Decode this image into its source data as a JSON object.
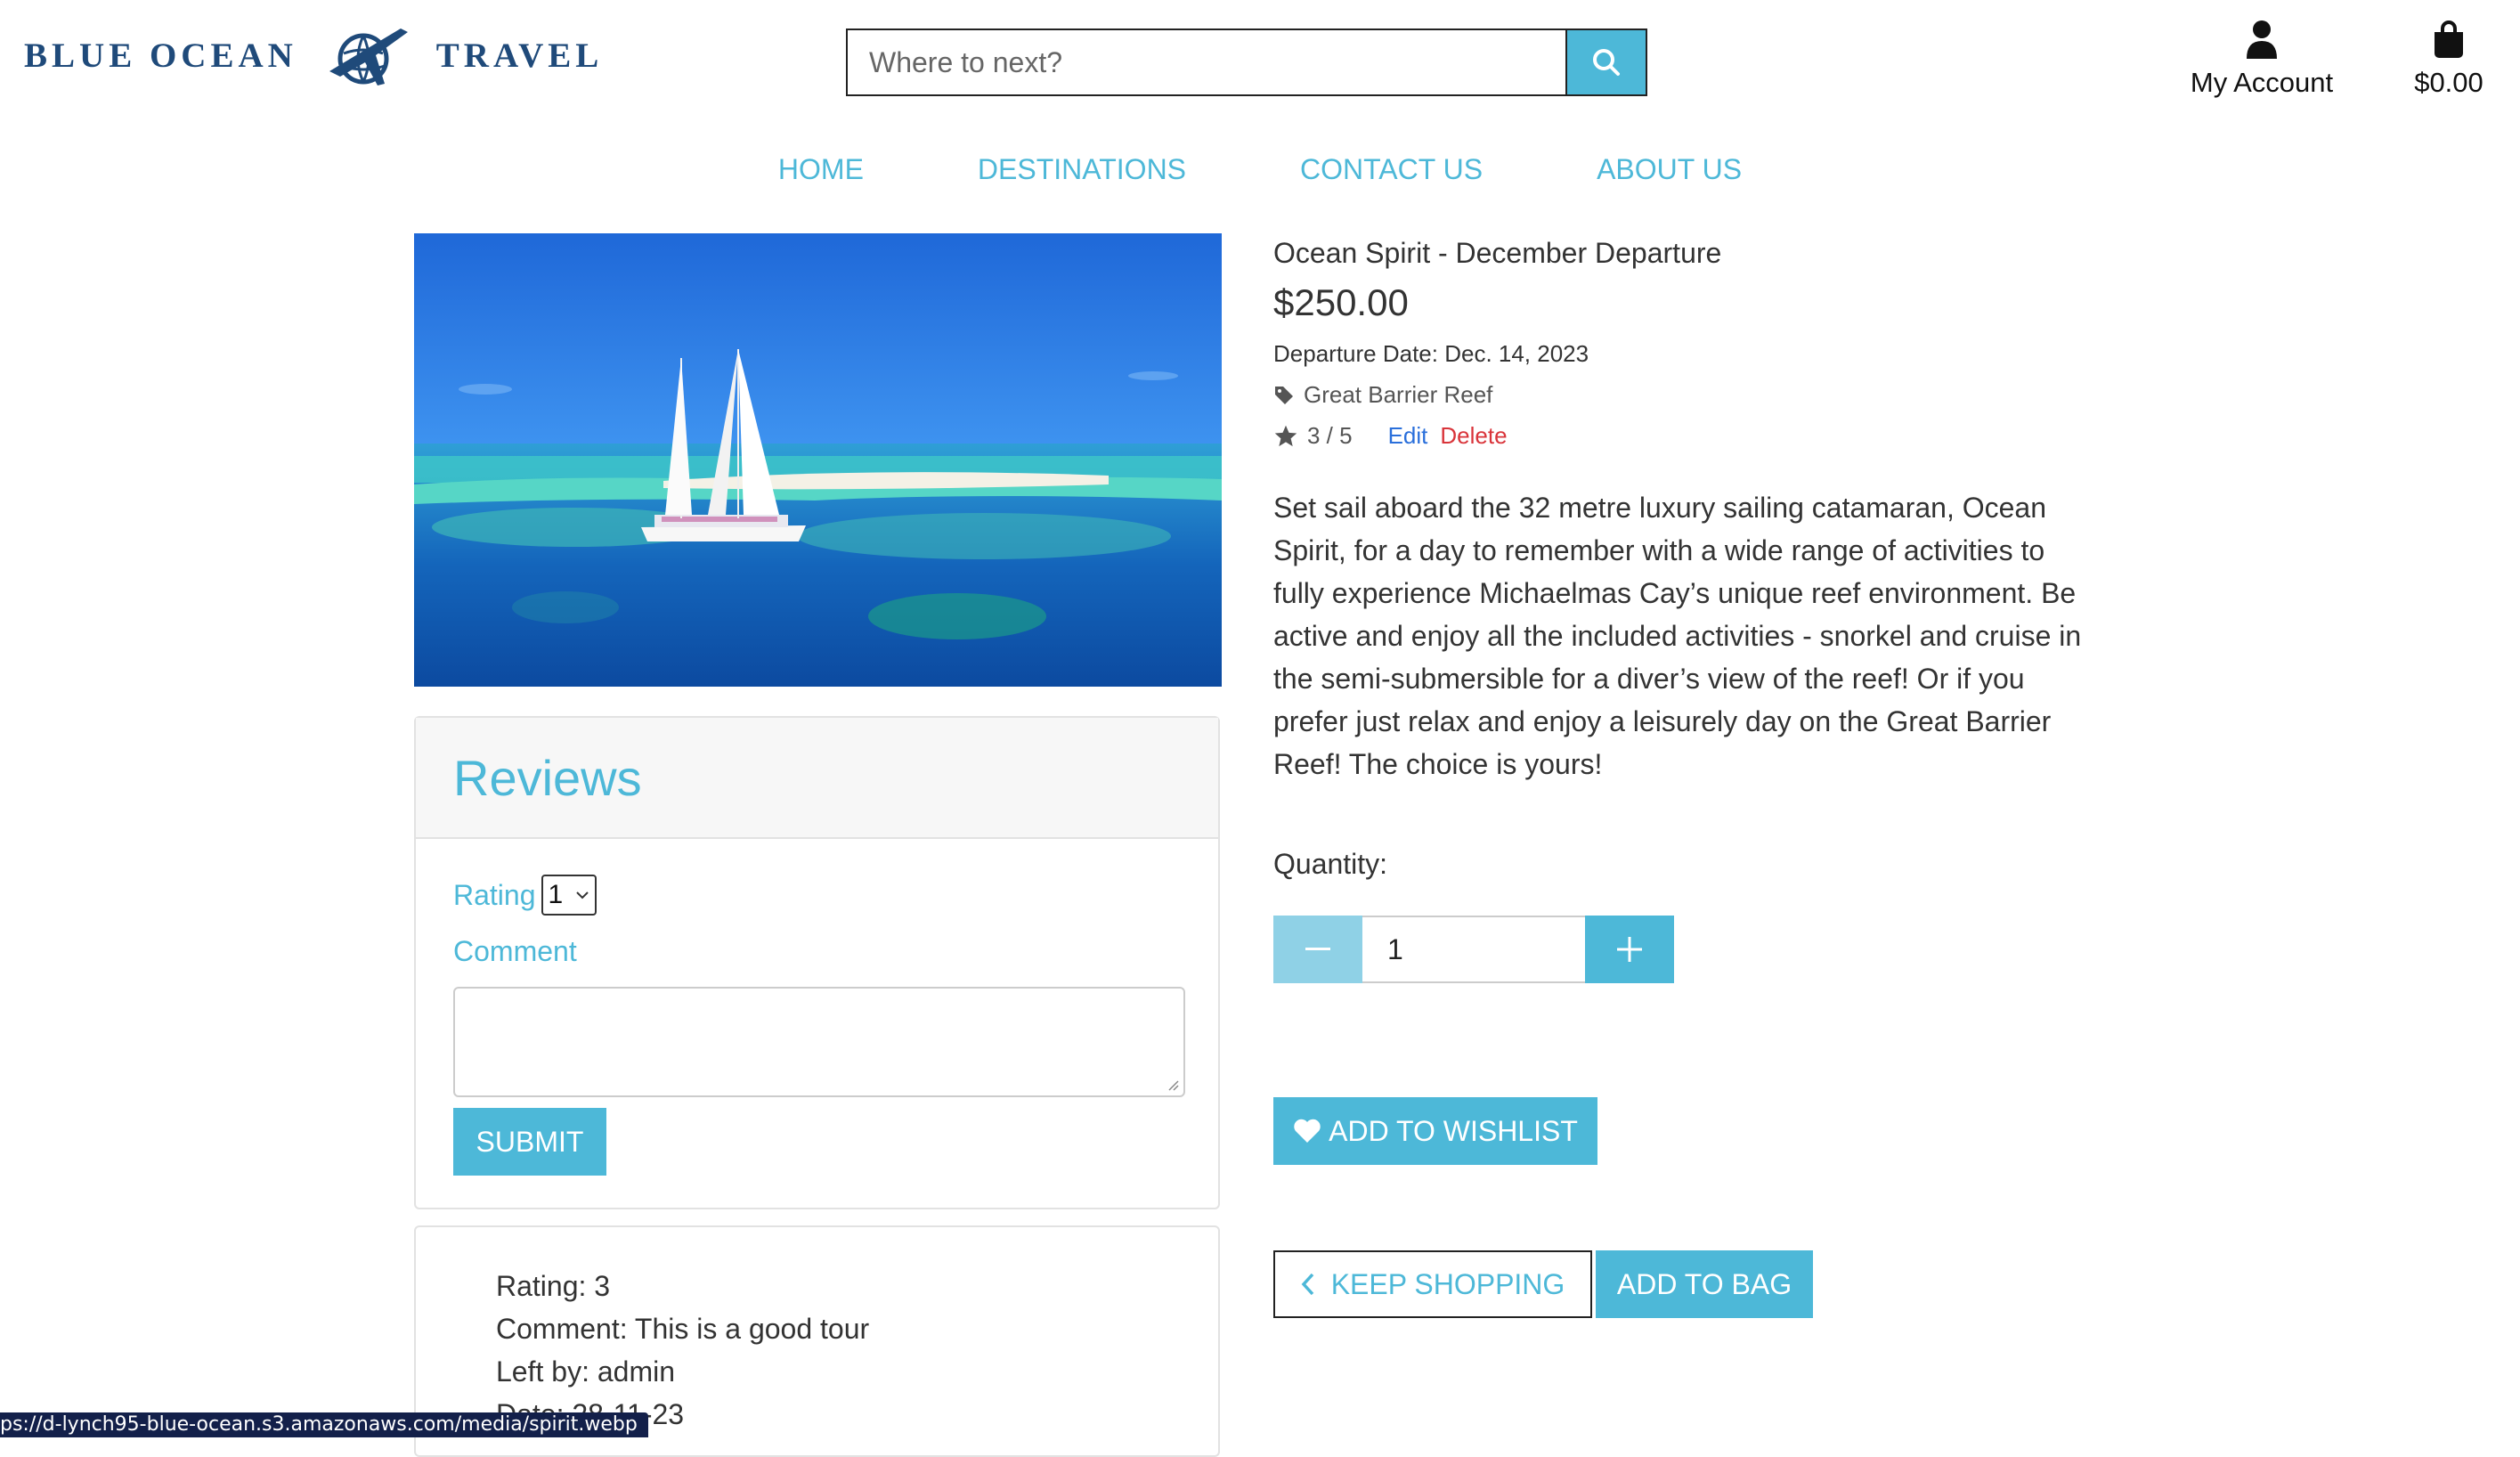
{
  "header": {
    "brand_left": "BLUE OCEAN",
    "brand_right": "TRAVEL",
    "search": {
      "placeholder": "Where to next?"
    },
    "account_label": "My Account",
    "bag_total": "$0.00"
  },
  "nav": {
    "items": [
      {
        "label": "HOME"
      },
      {
        "label": "DESTINATIONS"
      },
      {
        "label": "CONTACT US"
      },
      {
        "label": "ABOUT US"
      }
    ]
  },
  "product": {
    "title": "Ocean Spirit - December Departure",
    "price": "$250.00",
    "departure": "Departure Date: Dec. 14, 2023",
    "tag": "Great Barrier Reef",
    "rating": "3 / 5",
    "edit_label": "Edit",
    "delete_label": "Delete",
    "description": "Set sail aboard the 32 metre luxury sailing catamaran, Ocean Spirit, for a day to remember with a wide range of activities to fully experience Michaelmas Cay’s unique reef environment. Be active and enjoy all the included activities - snorkel and cruise in the semi-submersible for a diver’s view of the reef! Or if you prefer just relax and enjoy a leisurely day on the Great Barrier Reef! The choice is yours!",
    "quantity_label": "Quantity:",
    "quantity_value": "1",
    "wishlist_label": "ADD TO WISHLIST",
    "keep_shopping_label": "KEEP SHOPPING",
    "add_to_bag_label": "ADD TO BAG"
  },
  "reviews": {
    "title": "Reviews",
    "rating_label": "Rating",
    "rating_selected": "1",
    "comment_label": "Comment",
    "submit_label": "SUBMIT",
    "items": [
      {
        "rating": "Rating: 3",
        "comment": "Comment: This is a good tour",
        "left_by": "Left by: admin",
        "date": "Date: 28-11-23"
      }
    ]
  },
  "status_bar": {
    "url": "ps://d-lynch95-blue-ocean.s3.amazonaws.com/media/spirit.webp"
  },
  "colors": {
    "accent": "#4db8d8",
    "brand": "#1f4a7a",
    "delete": "#d9343a",
    "edit": "#2a6fdb"
  }
}
